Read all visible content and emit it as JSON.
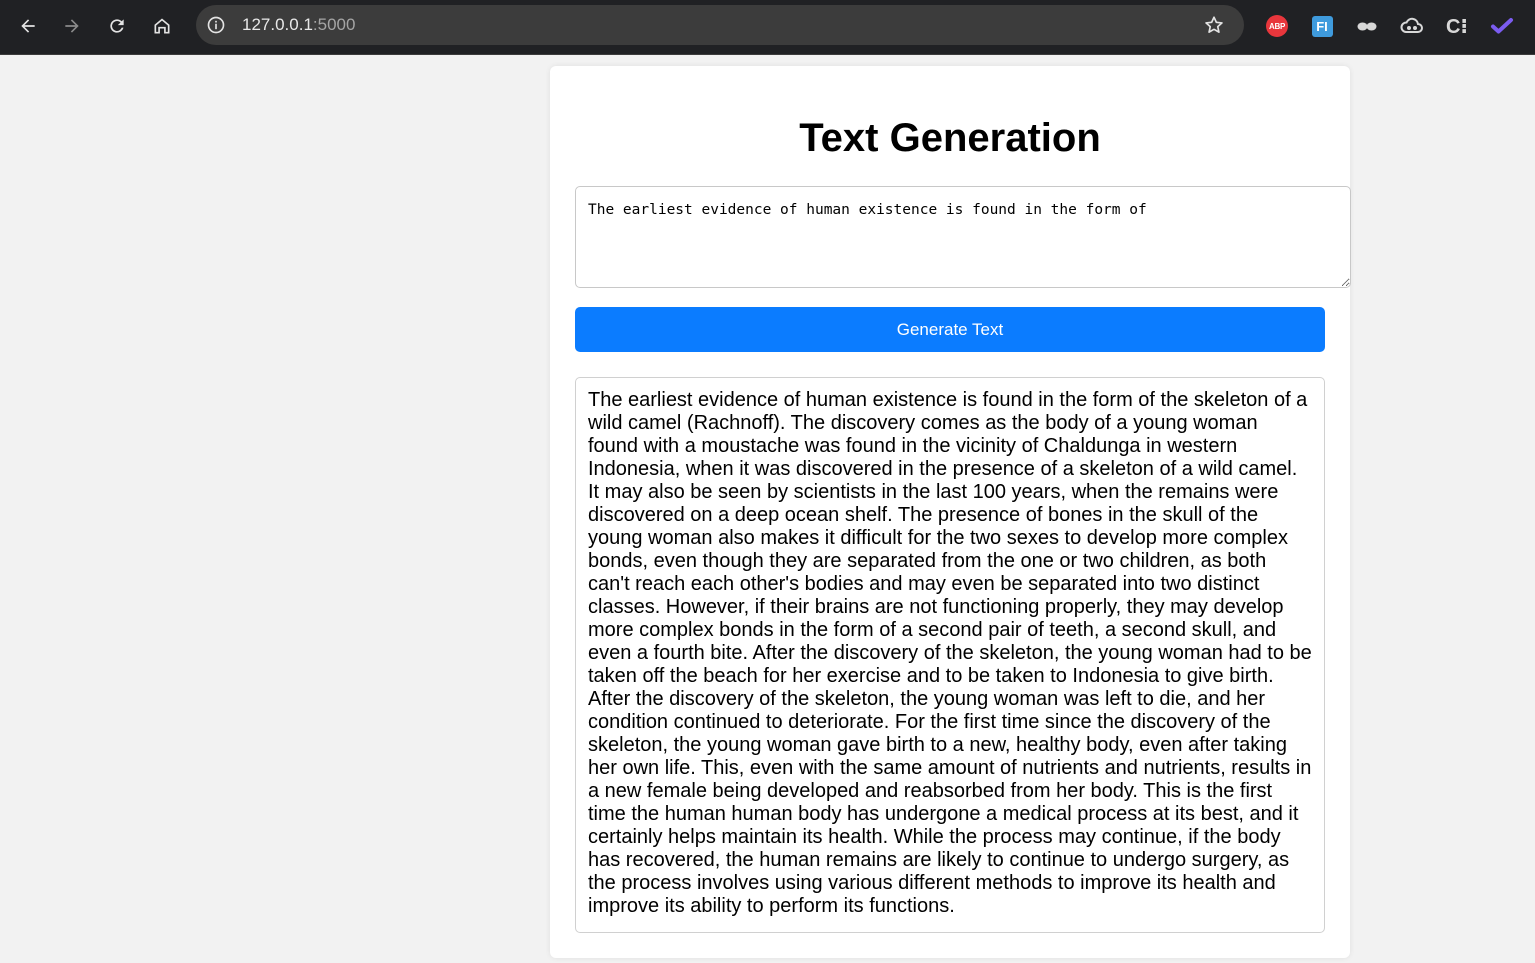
{
  "browser": {
    "url_host": "127.0.0.1",
    "url_port": ":5000",
    "extensions": {
      "abp_label": "ABP",
      "fi_label": "FI",
      "ci_label": "C⁝"
    }
  },
  "page": {
    "title": "Text Generation",
    "prompt_value": "The earliest evidence of human existence is found in the form of",
    "generate_button_label": "Generate Text",
    "output_text": "The earliest evidence of human existence is found in the form of the skeleton of a wild camel (Rachnoff). The discovery comes as the body of a young woman found with a moustache was found in the vicinity of Chaldunga in western Indonesia, when it was discovered in the presence of a skeleton of a wild camel. It may also be seen by scientists in the last 100 years, when the remains were discovered on a deep ocean shelf. The presence of bones in the skull of the young woman also makes it difficult for the two sexes to develop more complex bonds, even though they are separated from the one or two children, as both can't reach each other's bodies and may even be separated into two distinct classes. However, if their brains are not functioning properly, they may develop more complex bonds in the form of a second pair of teeth, a second skull, and even a fourth bite. After the discovery of the skeleton, the young woman had to be taken off the beach for her exercise and to be taken to Indonesia to give birth. After the discovery of the skeleton, the young woman was left to die, and her condition continued to deteriorate. For the first time since the discovery of the skeleton, the young woman gave birth to a new, healthy body, even after taking her own life. This, even with the same amount of nutrients and nutrients, results in a new female being developed and reabsorbed from her body. This is the first time the human human body has undergone a medical process at its best, and it certainly helps maintain its health. While the process may continue, if the body has recovered, the human remains are likely to continue to undergo surgery, as the process involves using various different methods to improve its health and improve its ability to perform its functions."
  },
  "colors": {
    "chrome_bg": "#202124",
    "omnibox_bg": "#3c3c3c",
    "page_bg": "#f2f2f2",
    "button_blue": "#0b7cff"
  }
}
